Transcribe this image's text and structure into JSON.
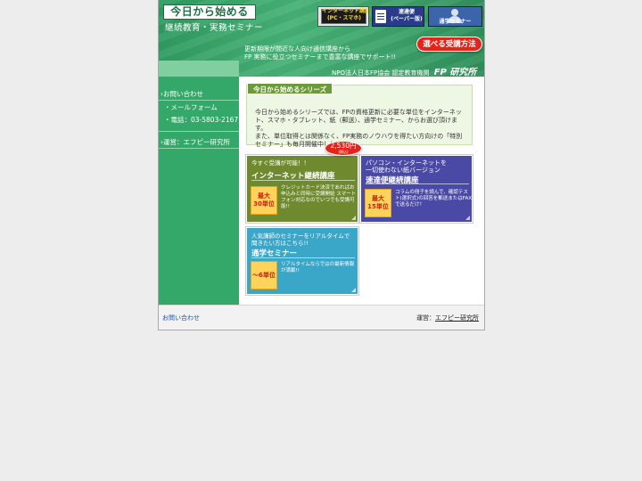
{
  "header": {
    "logo_title": "今日から始める",
    "logo_subtitle": "継続教育・実務セミナー",
    "buttons": {
      "internet": {
        "line1": "インターネット講座",
        "line2": "(PC・スマホ)"
      },
      "postal": {
        "line1": "速達便",
        "line2": "(ペーパー版)"
      },
      "seminar": {
        "label": "通学セミナー"
      }
    },
    "promo_line1": "更新期限が間近な人向け通信講座から",
    "promo_line2": "FP 実務に役立つセミナーまで豊富な講座でサポート!!",
    "choose_badge": "選べる受講方法",
    "org_text": "NPO法人日本FP協会 認定教育機関",
    "org_logo": "FP 研究所"
  },
  "sidebar": {
    "contact": "お問い合わせ",
    "mail_form": "・メールフォーム",
    "phone": "・電話：03-5803-2167",
    "operator": "運営：エフピー研究所"
  },
  "intro": {
    "tab": "今日から始めるシリーズ",
    "para1": "今日から始めるシリーズでは、FPの資格更新に必要な単位をインターネット、スマホ・タブレット、紙（郵送）、通学セミナー、からお選び頂けます。",
    "para2": "また、単位取得とは関係なく、FP実務のノウハウを得たい方向けの「特別セミナー」も毎月開催中！！"
  },
  "cards": {
    "internet": {
      "price": "2,530円",
      "price_note": "(税込)",
      "subtitle": "今すぐ受講が可能！！",
      "title": "インターネット継続講座",
      "badge_top": "最大",
      "badge_bottom": "30単位",
      "desc": "クレジットカード決済であればお申込みと同時に受講開始 スマートフォン対応なのでいつでも受講可能!!"
    },
    "postal": {
      "subtitle1": "パソコン・インターネットを",
      "subtitle2": "一切使わない紙バージョン",
      "title": "速達便継続講座",
      "badge_top": "最大",
      "badge_bottom": "15単位",
      "desc": "コラムの冊子を読んで、確認テスト(選択式)の回答を郵送またはFAXで送るだけ！"
    },
    "seminar": {
      "subtitle1": "人気講師のセミナーをリアルタイムで",
      "subtitle2": "聞きたい方はこちら!!",
      "title": "通学セミナー",
      "badge": "〜6単位",
      "desc": "リアルタイムならではの最新情報が満載!!"
    }
  },
  "footer": {
    "contact": "お問い合わせ",
    "operator_label": "運営：",
    "operator_link": "エフピー研究所"
  },
  "colors": {
    "brand_green": "#33a869",
    "internet_card": "#6f8a2e",
    "postal_card": "#4a4aa6",
    "seminar_card": "#3aa6c8",
    "accent_red": "#e1251b",
    "badge_yellow": "#ffd25a"
  }
}
